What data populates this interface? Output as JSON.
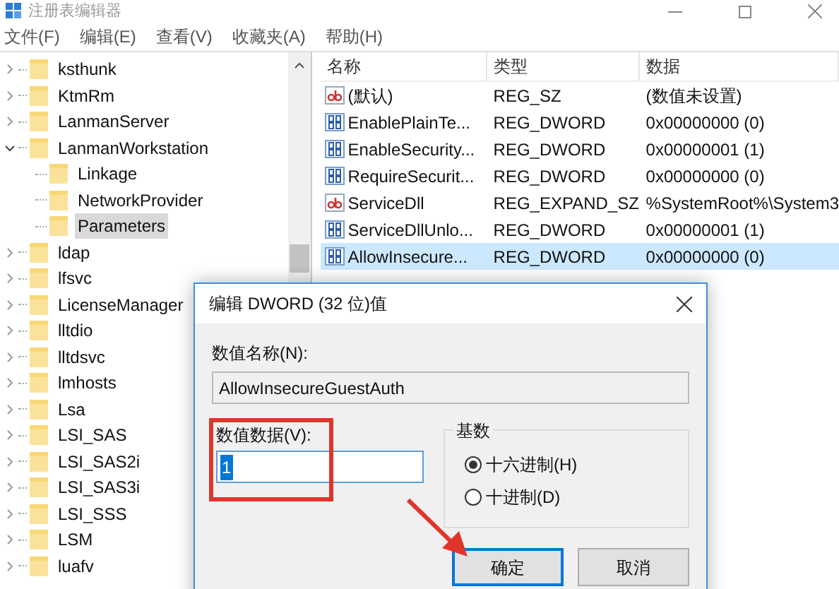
{
  "window": {
    "title": "注册表编辑器"
  },
  "menu": [
    "文件(F)",
    "编辑(E)",
    "查看(V)",
    "收藏夹(A)",
    "帮助(H)"
  ],
  "tree": [
    {
      "label": "ksthunk",
      "expanded": false,
      "selected": false
    },
    {
      "label": "KtmRm",
      "expanded": false,
      "selected": false
    },
    {
      "label": "LanmanServer",
      "expanded": false,
      "selected": false
    },
    {
      "label": "LanmanWorkstation",
      "expanded": true,
      "selected": false,
      "children": [
        {
          "label": "Linkage",
          "selected": false
        },
        {
          "label": "NetworkProvider",
          "selected": false
        },
        {
          "label": "Parameters",
          "selected": true
        }
      ]
    },
    {
      "label": "ldap",
      "expanded": false,
      "selected": false
    },
    {
      "label": "lfsvc",
      "expanded": false,
      "selected": false
    },
    {
      "label": "LicenseManager",
      "expanded": false,
      "selected": false
    },
    {
      "label": "lltdio",
      "expanded": false,
      "selected": false
    },
    {
      "label": "lltdsvc",
      "expanded": false,
      "selected": false
    },
    {
      "label": "lmhosts",
      "expanded": false,
      "selected": false
    },
    {
      "label": "Lsa",
      "expanded": false,
      "selected": false
    },
    {
      "label": "LSI_SAS",
      "expanded": false,
      "selected": false
    },
    {
      "label": "LSI_SAS2i",
      "expanded": false,
      "selected": false
    },
    {
      "label": "LSI_SAS3i",
      "expanded": false,
      "selected": false
    },
    {
      "label": "LSI_SSS",
      "expanded": false,
      "selected": false
    },
    {
      "label": "LSM",
      "expanded": false,
      "selected": false
    },
    {
      "label": "luafv",
      "expanded": false,
      "selected": false
    }
  ],
  "table": {
    "columns": [
      "名称",
      "类型",
      "数据"
    ],
    "rows": [
      {
        "kind": "string",
        "name": "(默认)",
        "type": "REG_SZ",
        "data": "(数值未设置)",
        "selected": false
      },
      {
        "kind": "binary",
        "name": "EnablePlainTe...",
        "type": "REG_DWORD",
        "data": "0x00000000 (0)",
        "selected": false
      },
      {
        "kind": "binary",
        "name": "EnableSecurity...",
        "type": "REG_DWORD",
        "data": "0x00000001 (1)",
        "selected": false
      },
      {
        "kind": "binary",
        "name": "RequireSecurit...",
        "type": "REG_DWORD",
        "data": "0x00000000 (0)",
        "selected": false
      },
      {
        "kind": "string",
        "name": "ServiceDll",
        "type": "REG_EXPAND_SZ",
        "data": "%SystemRoot%\\System3",
        "selected": false
      },
      {
        "kind": "binary",
        "name": "ServiceDllUnlo...",
        "type": "REG_DWORD",
        "data": "0x00000001 (1)",
        "selected": false
      },
      {
        "kind": "binary",
        "name": "AllowInsecure...",
        "type": "REG_DWORD",
        "data": "0x00000000 (0)",
        "selected": true
      }
    ]
  },
  "dialog": {
    "title": "编辑 DWORD (32 位)值",
    "name_label": "数值名称(N):",
    "name_value": "AllowInsecureGuestAuth",
    "data_label": "数值数据(V):",
    "data_value": "1",
    "base": {
      "title": "基数",
      "options": [
        {
          "label": "十六进制(H)",
          "selected": true
        },
        {
          "label": "十进制(D)",
          "selected": false
        }
      ]
    },
    "buttons": [
      {
        "label": "确定",
        "default": true
      },
      {
        "label": "取消",
        "default": false
      }
    ]
  }
}
